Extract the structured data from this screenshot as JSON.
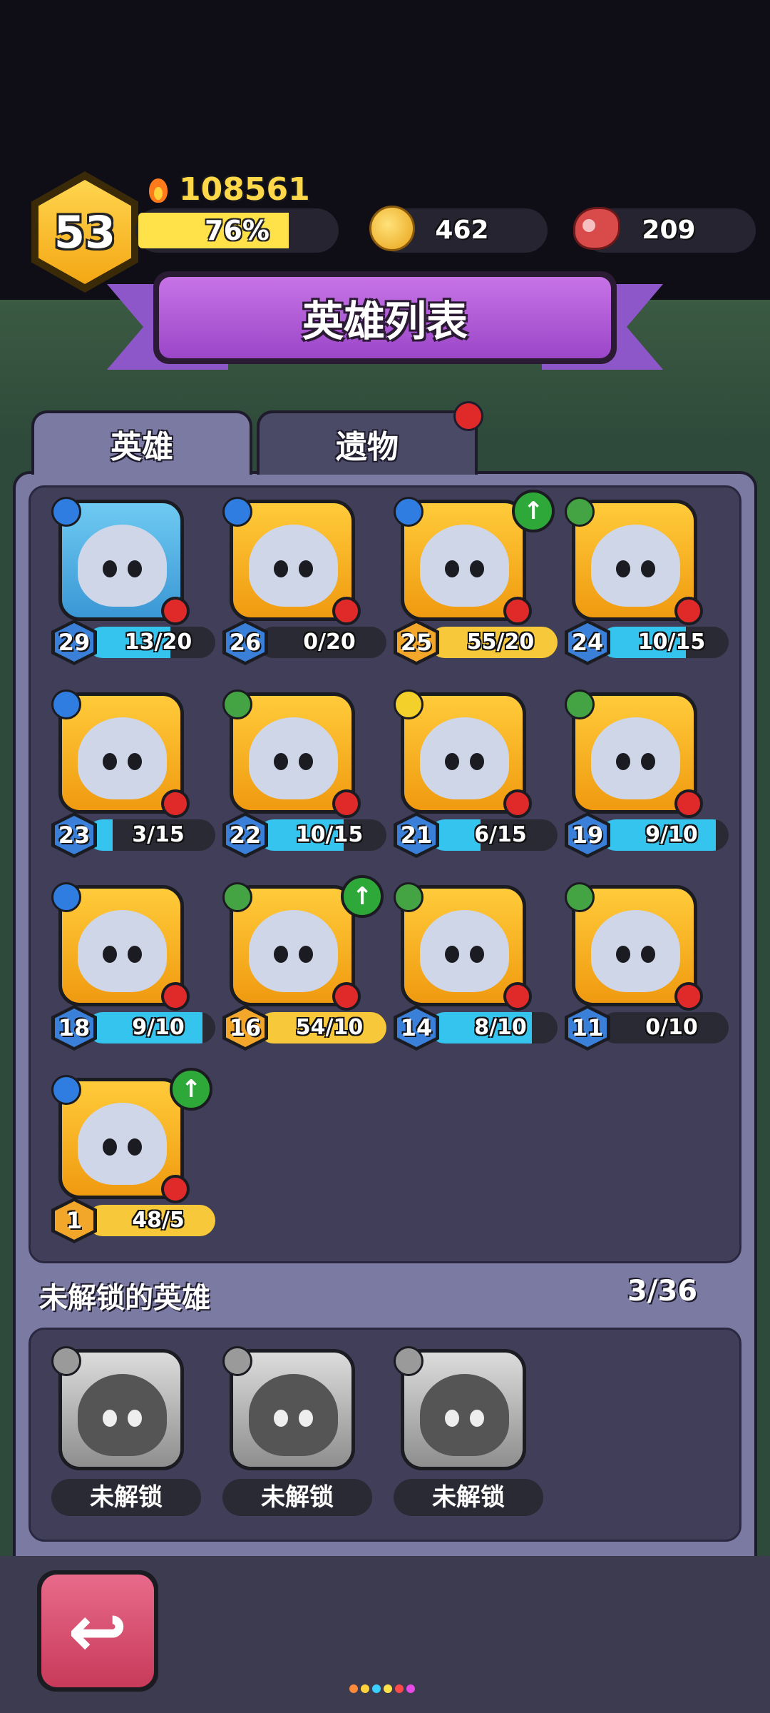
{
  "header": {
    "level": "53",
    "power": "108561",
    "xp_percent_label": "76%",
    "xp_fraction": 0.76,
    "coins": "462",
    "meat": "209"
  },
  "title": "英雄列表",
  "tabs": [
    {
      "label": "英雄",
      "active": true
    },
    {
      "label": "遗物",
      "active": false,
      "has_notification": true
    }
  ],
  "heroes": [
    {
      "level": "29",
      "shards": "13/20",
      "class_icon": "blue",
      "bg": "blue",
      "has_red_dot": true,
      "can_upgrade": false
    },
    {
      "level": "26",
      "shards": "0/20",
      "class_icon": "blue",
      "bg": "orange",
      "has_red_dot": true,
      "can_upgrade": false
    },
    {
      "level": "25",
      "shards": "55/20",
      "class_icon": "blue",
      "bg": "orange",
      "has_red_dot": true,
      "can_upgrade": true
    },
    {
      "level": "24",
      "shards": "10/15",
      "class_icon": "green",
      "bg": "orange",
      "has_red_dot": true,
      "can_upgrade": false
    },
    {
      "level": "23",
      "shards": "3/15",
      "class_icon": "blue",
      "bg": "orange",
      "has_red_dot": true,
      "can_upgrade": false
    },
    {
      "level": "22",
      "shards": "10/15",
      "class_icon": "green",
      "bg": "orange",
      "has_red_dot": true,
      "can_upgrade": false
    },
    {
      "level": "21",
      "shards": "6/15",
      "class_icon": "yellow",
      "bg": "orange",
      "has_red_dot": true,
      "can_upgrade": false
    },
    {
      "level": "19",
      "shards": "9/10",
      "class_icon": "green",
      "bg": "orange",
      "has_red_dot": true,
      "can_upgrade": false
    },
    {
      "level": "18",
      "shards": "9/10",
      "class_icon": "blue",
      "bg": "orange",
      "has_red_dot": true,
      "can_upgrade": false
    },
    {
      "level": "16",
      "shards": "54/10",
      "class_icon": "green",
      "bg": "orange",
      "has_red_dot": true,
      "can_upgrade": true
    },
    {
      "level": "14",
      "shards": "8/10",
      "class_icon": "green",
      "bg": "orange",
      "has_red_dot": true,
      "can_upgrade": false
    },
    {
      "level": "11",
      "shards": "0/10",
      "class_icon": "green",
      "bg": "orange",
      "has_red_dot": true,
      "can_upgrade": false
    },
    {
      "level": "1",
      "shards": "48/5",
      "class_icon": "blue",
      "bg": "orange",
      "has_red_dot": true,
      "can_upgrade": true
    }
  ],
  "locked_section": {
    "title": "未解锁的英雄",
    "count": "3/36",
    "heroes": [
      {
        "label": "未解锁"
      },
      {
        "label": "未解锁"
      },
      {
        "label": "未解锁"
      }
    ]
  },
  "colors": {
    "accent_purple": "#9b46c8",
    "shard_cyan": "#35c4ee",
    "shard_gold": "#f7c93a",
    "notify_red": "#e02a2a",
    "upgrade_green": "#2fa83a"
  },
  "icons": {
    "back": "back-arrow-icon",
    "power": "flame-icon",
    "coin": "coin-icon",
    "meat": "meat-icon",
    "upgrade": "arrow-up-icon"
  }
}
